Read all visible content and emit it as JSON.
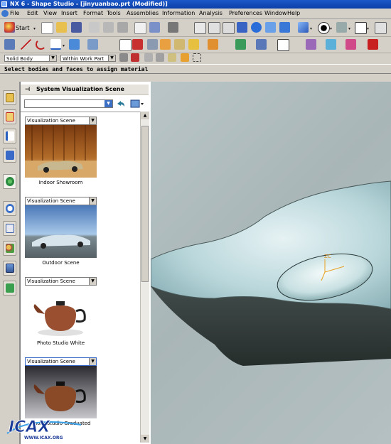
{
  "window": {
    "title": "NX 6 - Shape Studio - [jinyuanbao.prt (Modified)]"
  },
  "menu": [
    "File",
    "Edit",
    "View",
    "Insert",
    "Format",
    "Tools",
    "Assemblies",
    "Information",
    "Analysis",
    "Preferences",
    "Window",
    "Help"
  ],
  "toolbar": {
    "start_label": "Start"
  },
  "selection": {
    "filter_value": "Solid Body",
    "scope_value": "Within Work Part"
  },
  "status": {
    "prompt": "Select bodies and faces to assign material"
  },
  "panel": {
    "title": "System Visualization Scene",
    "search_value": "",
    "scenes": [
      {
        "type_value": "Visualization Scene",
        "caption": "Indoor Showroom"
      },
      {
        "type_value": "Visualization Scene",
        "caption": "Outdoor Scene"
      },
      {
        "type_value": "Visualization Scene",
        "caption": "Photo Studio White"
      },
      {
        "type_value": "Visualization Scene",
        "caption": "Photo Studio Graduated"
      }
    ]
  },
  "viewport": {
    "axis_label": "ZC"
  },
  "watermark": {
    "logo_text": "ICAX",
    "url_text": "WWW.ICAX.ORG"
  },
  "colors": {
    "title_bar": "#0a3fa8",
    "viewport_bg": "#b4c0c2",
    "model_top": "#a8c8cc",
    "model_side": "#3a4442"
  }
}
